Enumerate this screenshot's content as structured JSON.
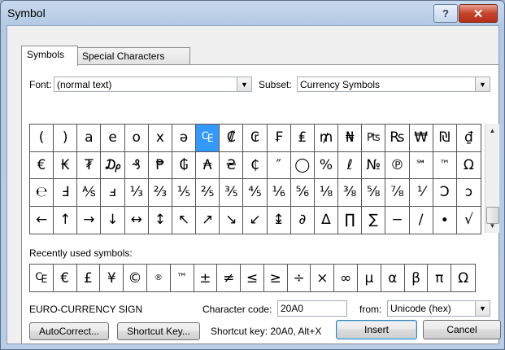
{
  "window": {
    "title": "Symbol",
    "help_label": "?",
    "close_label": "✕"
  },
  "tabs": [
    {
      "label": "Symbols",
      "active": true
    },
    {
      "label": "Special Characters",
      "active": false
    }
  ],
  "font": {
    "label": "Font:",
    "value": "(normal text)"
  },
  "subset": {
    "label": "Subset:",
    "value": "Currency Symbols"
  },
  "symbol_grid": [
    [
      "(",
      ")",
      "a",
      "e",
      "o",
      "x",
      "ə",
      "₠",
      "₡",
      "₢",
      "₣",
      "₤",
      "₥",
      "₦",
      "₧",
      "₨",
      "₩",
      "₪",
      "₫"
    ],
    [
      "€",
      "₭",
      "₮",
      "₯",
      "₰",
      "₱",
      "₲",
      "₳",
      "₴",
      "₵",
      "″",
      "◯",
      "%",
      "ℓ",
      "№",
      "℗",
      "℠",
      "™",
      "Ω"
    ],
    [
      "℮",
      "Ⅎ",
      "⅍",
      "ⅎ",
      "⅓",
      "⅔",
      "⅕",
      "⅖",
      "⅗",
      "⅘",
      "⅙",
      "⅚",
      "⅛",
      "⅜",
      "⅝",
      "⅞",
      "⅟",
      "Ↄ",
      "ↄ"
    ],
    [
      "←",
      "↑",
      "→",
      "↓",
      "↔",
      "↕",
      "↖",
      "↗",
      "↘",
      "↙",
      "↨",
      "∂",
      "∆",
      "∏",
      "∑",
      "−",
      "∕",
      "∙",
      "√"
    ]
  ],
  "selected_symbol": "₠",
  "recent_label": "Recently used symbols:",
  "recent_symbols": [
    "₠",
    "€",
    "£",
    "¥",
    "©",
    "®",
    "™",
    "±",
    "≠",
    "≤",
    "≥",
    "÷",
    "×",
    "∞",
    "µ",
    "α",
    "β",
    "π",
    "Ω"
  ],
  "char_name": "EURO-CURRENCY SIGN",
  "char_code": {
    "label": "Character code:",
    "value": "20A0"
  },
  "from": {
    "label": "from:",
    "value": "Unicode (hex)"
  },
  "autocorrect_label": "AutoCorrect...",
  "shortcut_key_label": "Shortcut Key...",
  "shortcut_info": "Shortcut key: 20A0, Alt+X",
  "insert_label": "Insert",
  "cancel_label": "Cancel"
}
